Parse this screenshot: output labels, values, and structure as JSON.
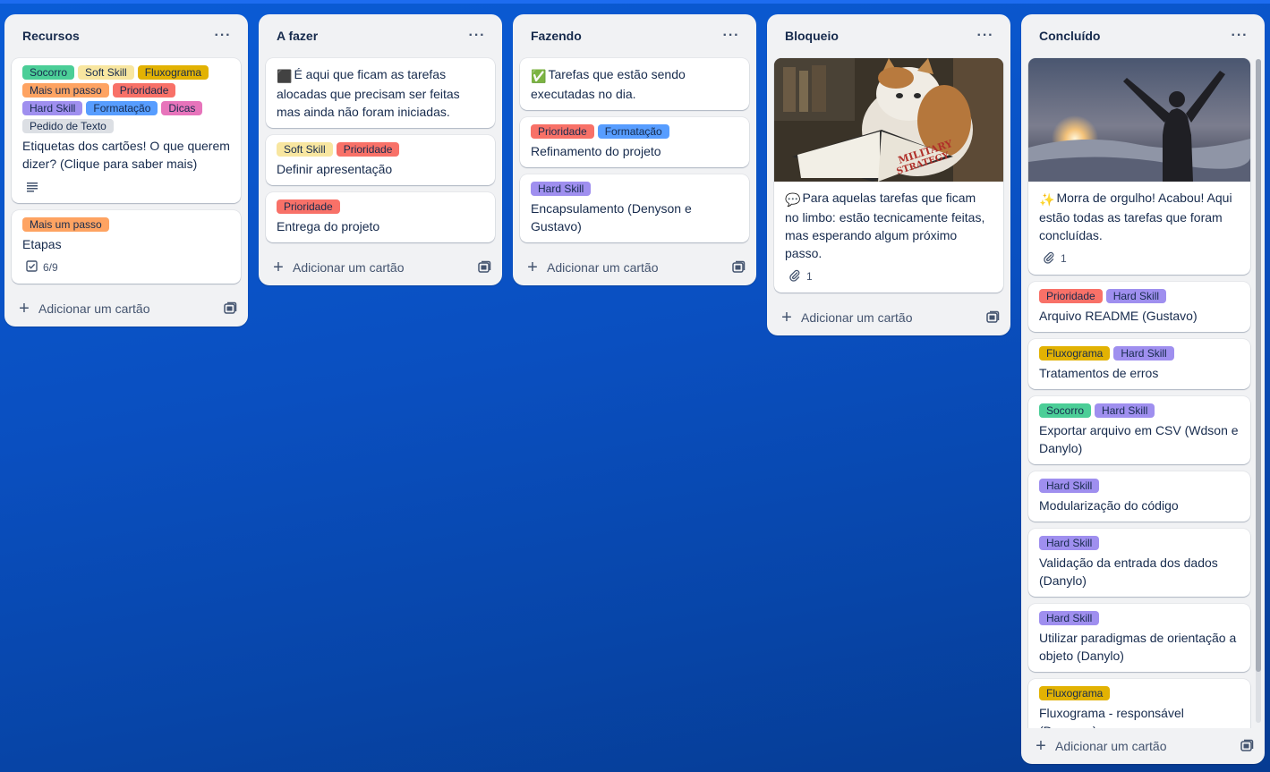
{
  "lists": [
    {
      "title": "Recursos",
      "add_label": "Adicionar um cartão",
      "cards": [
        {
          "labels": [
            "Socorro",
            "Soft Skill",
            "Fluxograma",
            "Mais um passo",
            "Prioridade",
            "Hard Skill",
            "Formatação",
            "Dicas",
            "Pedido de Texto"
          ],
          "title": "Etiquetas dos cartões! O que querem dizer? (Clique para saber mais)",
          "has_description": true
        },
        {
          "labels": [
            "Mais um passo"
          ],
          "title": "Etapas",
          "checklist": "6/9"
        }
      ]
    },
    {
      "title": "A fazer",
      "add_label": "Adicionar um cartão",
      "cards": [
        {
          "emoji": "⬛",
          "title": "É aqui que ficam as tarefas alocadas que precisam ser feitas mas ainda não foram iniciadas."
        },
        {
          "labels": [
            "Soft Skill",
            "Prioridade"
          ],
          "title": "Definir apresentação"
        },
        {
          "labels": [
            "Prioridade"
          ],
          "title": "Entrega do projeto"
        }
      ]
    },
    {
      "title": "Fazendo",
      "add_label": "Adicionar um cartão",
      "cards": [
        {
          "emoji": "✅",
          "title": "Tarefas que estão sendo executadas no dia."
        },
        {
          "labels": [
            "Prioridade",
            "Formatação"
          ],
          "title": "Refinamento do projeto"
        },
        {
          "labels": [
            "Hard Skill"
          ],
          "title": "Encapsulamento (Denyson e Gustavo)"
        }
      ]
    },
    {
      "title": "Bloqueio",
      "add_label": "Adicionar um cartão",
      "cards": [
        {
          "cover": "cat-reading-book",
          "emoji": "💬",
          "title": "Para aquelas tarefas que ficam no limbo: estão tecnicamente feitas, mas esperando algum próximo passo.",
          "attachments": "1"
        }
      ]
    },
    {
      "title": "Concluído",
      "add_label": "Adicionar um cartão",
      "cards": [
        {
          "cover": "person-celebrating-sunset",
          "emoji": "✨",
          "title": "Morra de orgulho! Acabou! Aqui estão todas as tarefas que foram concluídas.",
          "attachments": "1"
        },
        {
          "labels": [
            "Prioridade",
            "Hard Skill"
          ],
          "title": "Arquivo README (Gustavo)"
        },
        {
          "labels": [
            "Fluxograma",
            "Hard Skill"
          ],
          "title": "Tratamentos de erros"
        },
        {
          "labels": [
            "Socorro",
            "Hard Skill"
          ],
          "title": "Exportar arquivo em CSV (Wdson e Danylo)"
        },
        {
          "labels": [
            "Hard Skill"
          ],
          "title": "Modularização do código"
        },
        {
          "labels": [
            "Hard Skill"
          ],
          "title": "Validação da entrada dos dados (Danylo)"
        },
        {
          "labels": [
            "Hard Skill"
          ],
          "title": "Utilizar paradigmas de orientação a objeto (Danylo)"
        },
        {
          "labels": [
            "Fluxograma"
          ],
          "title": "Fluxograma - responsável (Denyson)"
        }
      ]
    }
  ],
  "label_colors": {
    "Socorro": "#4bce97",
    "Soft Skill": "#f8e6a0",
    "Fluxograma": "#e2b203",
    "Mais um passo": "#fea362",
    "Prioridade": "#f87168",
    "Hard Skill": "#9f8fef",
    "Formatação": "#579dff",
    "Dicas": "#e774bb",
    "Pedido de Texto": "#dcdfe4"
  },
  "icons": {
    "list_menu": "ellipsis-icon",
    "add": "plus-icon",
    "template": "card-template-icon",
    "description": "description-icon",
    "checklist": "checklist-icon",
    "attachment": "paperclip-icon"
  }
}
